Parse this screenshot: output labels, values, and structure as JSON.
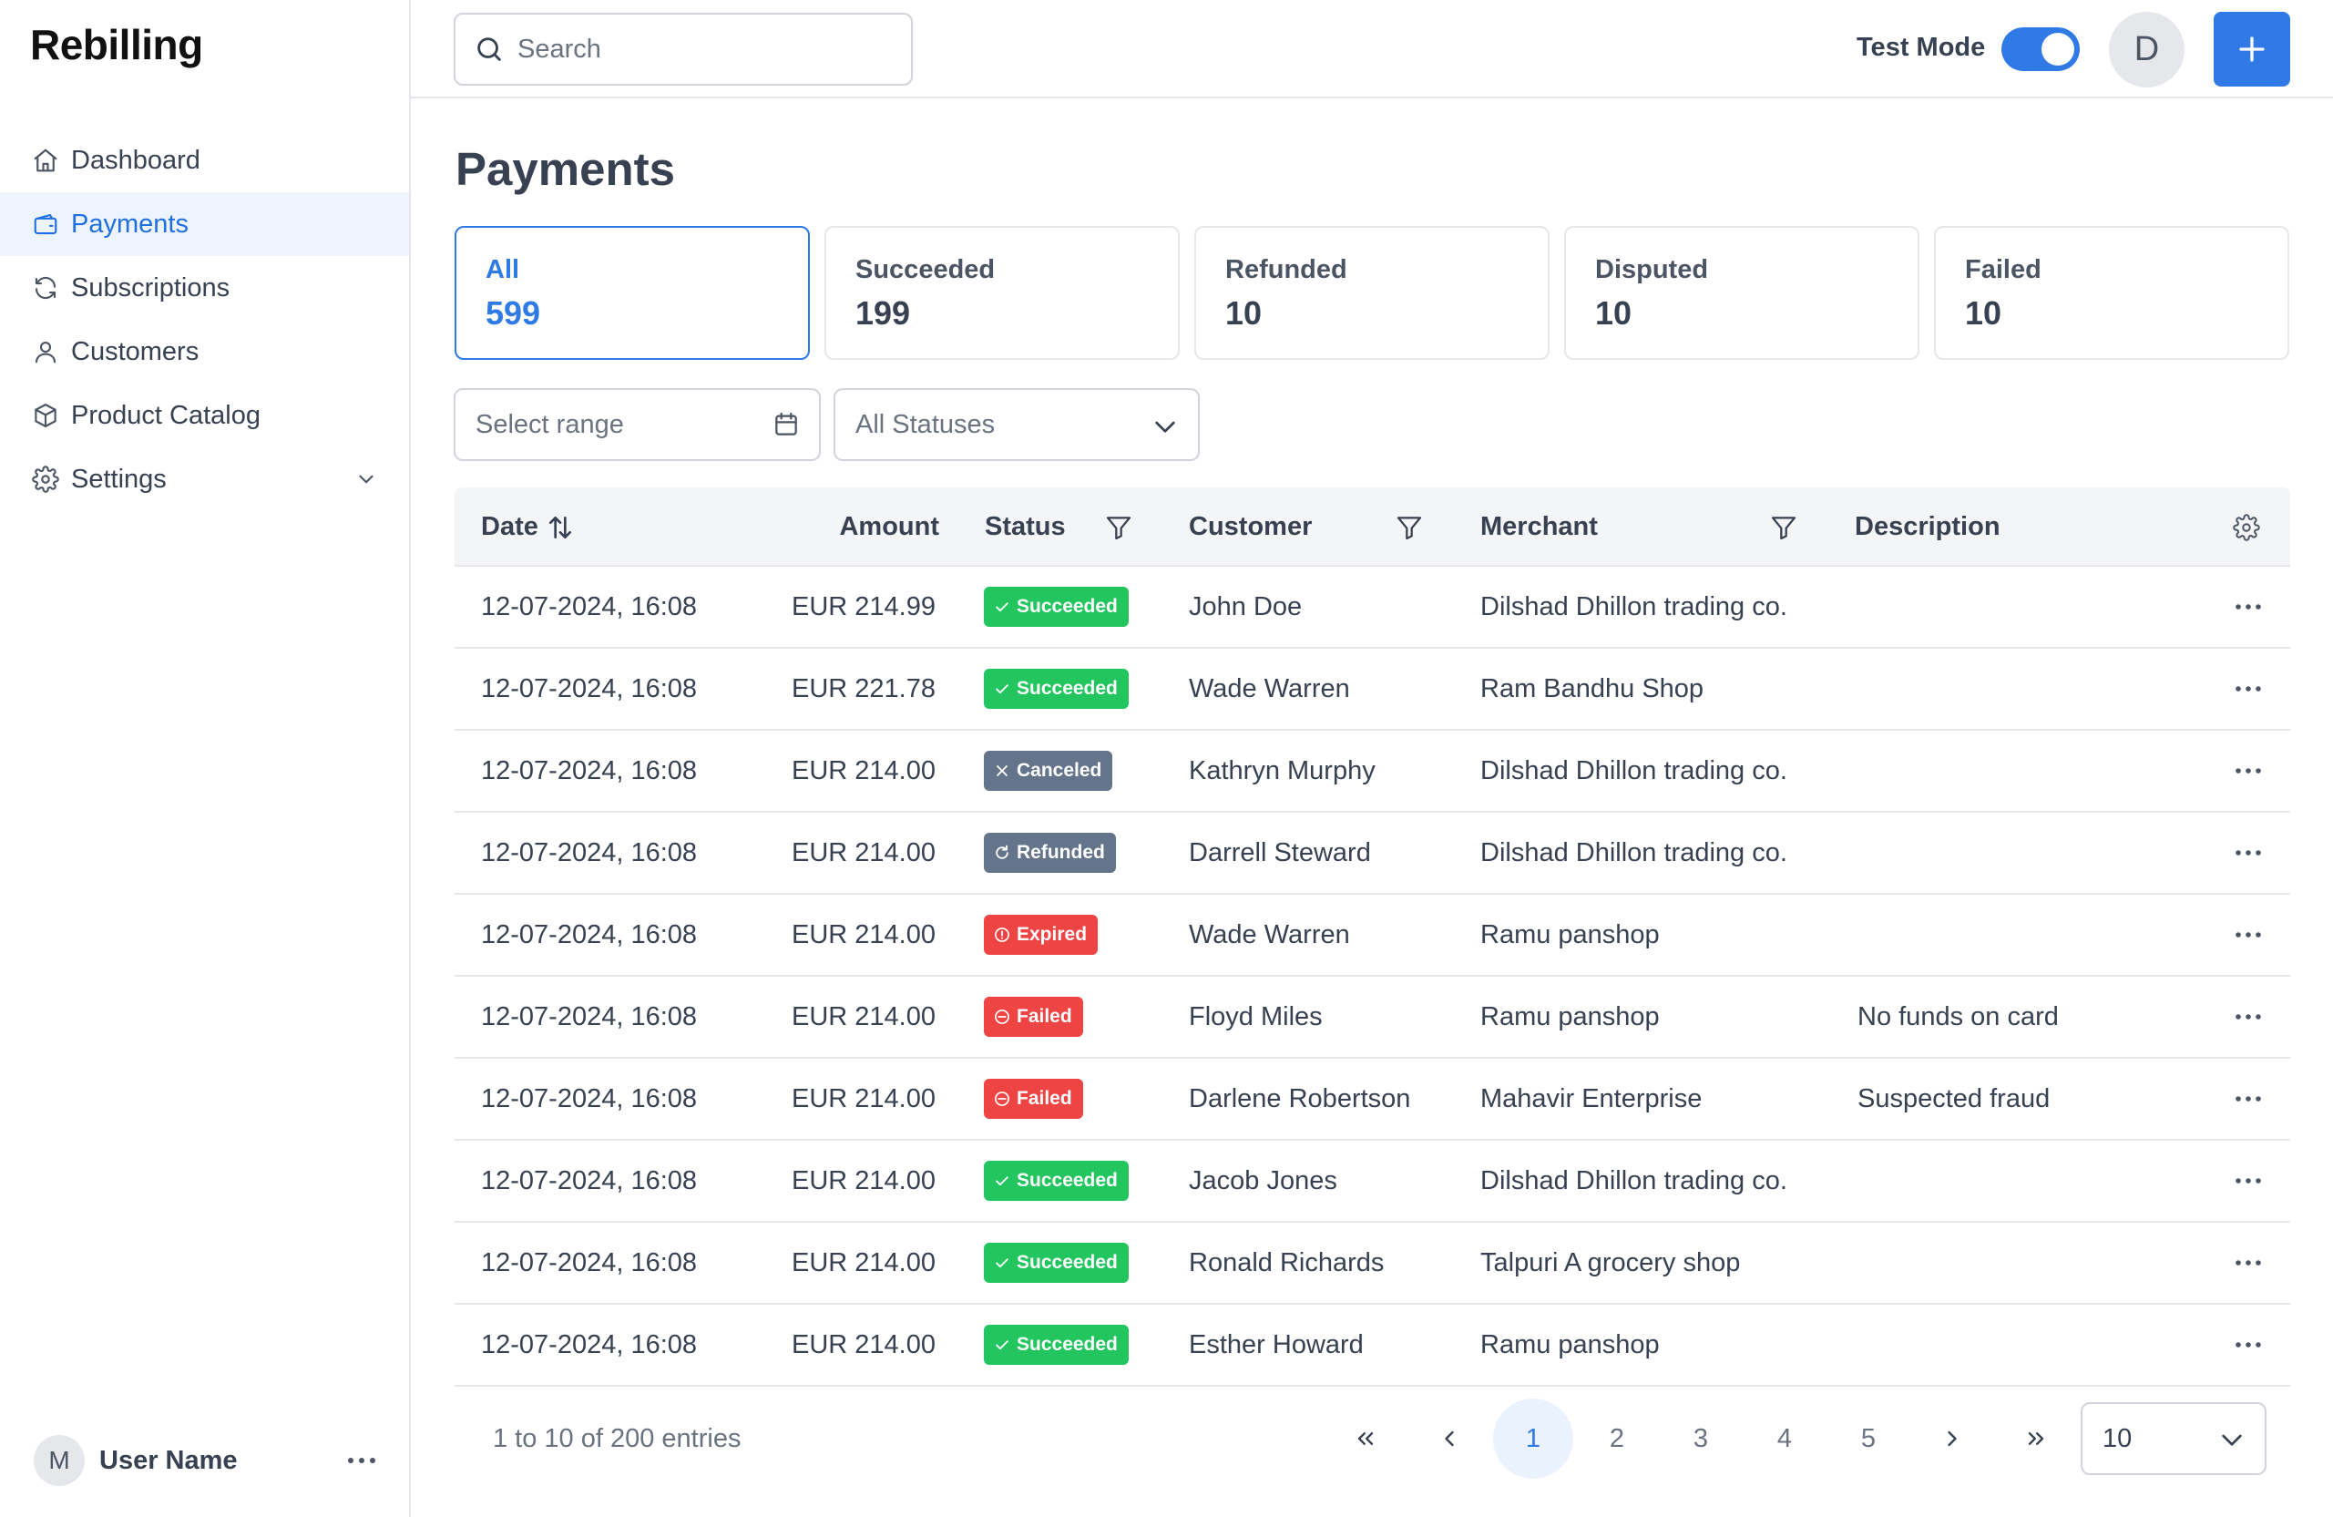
{
  "app": {
    "name": "Rebilling"
  },
  "sidebar": {
    "items": [
      {
        "label": "Dashboard",
        "icon": "home-icon",
        "active": false
      },
      {
        "label": "Payments",
        "icon": "wallet-icon",
        "active": true
      },
      {
        "label": "Subscriptions",
        "icon": "refresh-icon",
        "active": false
      },
      {
        "label": "Customers",
        "icon": "user-icon",
        "active": false
      },
      {
        "label": "Product Catalog",
        "icon": "box-icon",
        "active": false
      },
      {
        "label": "Settings",
        "icon": "gear-icon",
        "active": false
      }
    ],
    "user": {
      "initial": "M",
      "name": "User Name"
    }
  },
  "topbar": {
    "search_placeholder": "Search",
    "test_mode_label": "Test Mode",
    "test_mode_on": true,
    "avatar_initial": "D"
  },
  "page": {
    "title": "Payments",
    "cards": [
      {
        "label": "All",
        "value": "599",
        "active": true
      },
      {
        "label": "Succeeded",
        "value": "199",
        "active": false
      },
      {
        "label": "Refunded",
        "value": "10",
        "active": false
      },
      {
        "label": "Disputed",
        "value": "10",
        "active": false
      },
      {
        "label": "Failed",
        "value": "10",
        "active": false
      }
    ],
    "filters": {
      "range_placeholder": "Select range",
      "status_value": "All Statuses"
    }
  },
  "table": {
    "columns": {
      "date": "Date",
      "amount": "Amount",
      "status": "Status",
      "customer": "Customer",
      "merchant": "Merchant",
      "description": "Description"
    },
    "rows": [
      {
        "date": "12-07-2024, 16:08",
        "amount": "EUR 214.99",
        "status": "Succeeded",
        "customer": "John Doe",
        "merchant": "Dilshad Dhillon trading co.",
        "description": ""
      },
      {
        "date": "12-07-2024, 16:08",
        "amount": "EUR 221.78",
        "status": "Succeeded",
        "customer": "Wade Warren",
        "merchant": "Ram Bandhu Shop",
        "description": ""
      },
      {
        "date": "12-07-2024, 16:08",
        "amount": "EUR 214.00",
        "status": "Canceled",
        "customer": "Kathryn Murphy",
        "merchant": "Dilshad Dhillon trading co.",
        "description": ""
      },
      {
        "date": "12-07-2024, 16:08",
        "amount": "EUR 214.00",
        "status": "Refunded",
        "customer": "Darrell Steward",
        "merchant": "Dilshad Dhillon trading co.",
        "description": ""
      },
      {
        "date": "12-07-2024, 16:08",
        "amount": "EUR 214.00",
        "status": "Expired",
        "customer": "Wade Warren",
        "merchant": "Ramu panshop",
        "description": ""
      },
      {
        "date": "12-07-2024, 16:08",
        "amount": "EUR 214.00",
        "status": "Failed",
        "customer": "Floyd Miles",
        "merchant": "Ramu panshop",
        "description": "No funds on card"
      },
      {
        "date": "12-07-2024, 16:08",
        "amount": "EUR 214.00",
        "status": "Failed",
        "customer": "Darlene Robertson",
        "merchant": "Mahavir Enterprise",
        "description": "Suspected fraud"
      },
      {
        "date": "12-07-2024, 16:08",
        "amount": "EUR 214.00",
        "status": "Succeeded",
        "customer": "Jacob Jones",
        "merchant": "Dilshad Dhillon trading co.",
        "description": ""
      },
      {
        "date": "12-07-2024, 16:08",
        "amount": "EUR 214.00",
        "status": "Succeeded",
        "customer": "Ronald Richards",
        "merchant": "Talpuri A grocery shop",
        "description": ""
      },
      {
        "date": "12-07-2024, 16:08",
        "amount": "EUR 214.00",
        "status": "Succeeded",
        "customer": "Esther Howard",
        "merchant": "Ramu panshop",
        "description": ""
      }
    ]
  },
  "status_colors": {
    "Succeeded": "#22c55e",
    "Canceled": "#64748b",
    "Refunded": "#64748b",
    "Expired": "#ef4444",
    "Failed": "#ef4444"
  },
  "status_icons": {
    "Succeeded": "check-icon",
    "Canceled": "x-icon",
    "Refunded": "refresh-icon",
    "Expired": "alert-circle-icon",
    "Failed": "minus-circle-icon"
  },
  "pagination": {
    "summary": "1 to 10 of 200 entries",
    "pages": [
      "1",
      "2",
      "3",
      "4",
      "5"
    ],
    "current": "1",
    "page_size": "10"
  },
  "colors": {
    "accent": "#2f7ae5"
  }
}
